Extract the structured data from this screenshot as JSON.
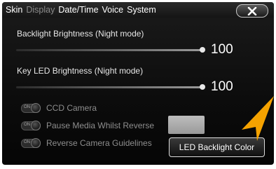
{
  "tabs": [
    {
      "label": "Skin",
      "active": true
    },
    {
      "label": "Display",
      "active": false
    },
    {
      "label": "Date/Time",
      "active": true
    },
    {
      "label": "Voice",
      "active": true
    },
    {
      "label": "System",
      "active": true
    }
  ],
  "close_icon": "close-x-icon",
  "backlight": {
    "label": "Backlight Brightness (Night mode)",
    "value": "100",
    "level_fraction": 1.0
  },
  "key_led": {
    "label": "Key LED Brightness (Night mode)",
    "value": "100",
    "level_fraction": 1.0
  },
  "toggles": [
    {
      "state_text": "ON",
      "label": "CCD Camera"
    },
    {
      "state_text": "ON",
      "label": "Pause Media Whilst Reverse"
    },
    {
      "state_text": "ON",
      "label": "Reverse Camera Guidelines"
    }
  ],
  "led_button": {
    "label": "LED Backlight Color"
  },
  "colors": {
    "accent_arrow": "#f5a200",
    "swatch": "#b0b0b0",
    "background": "#0c0c0c"
  }
}
